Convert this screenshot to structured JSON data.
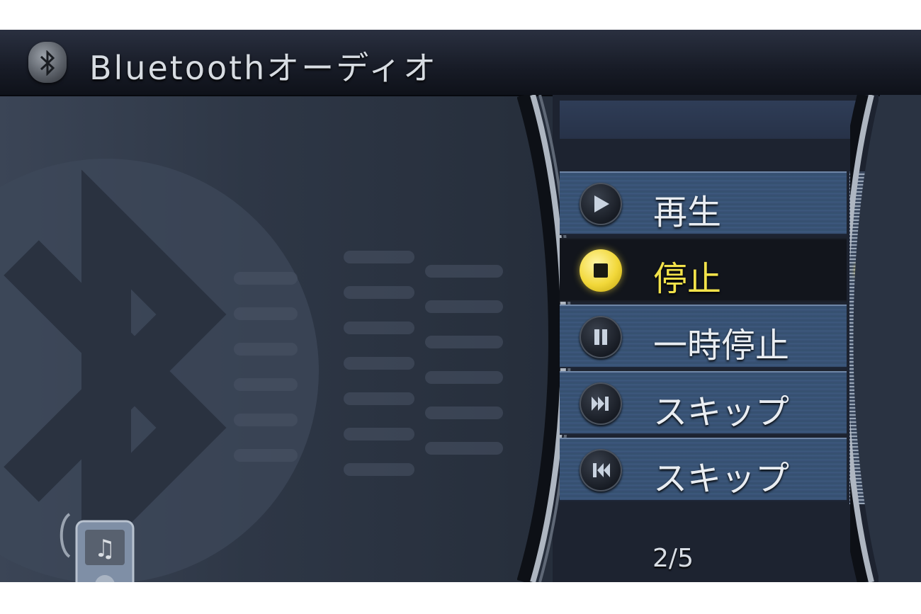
{
  "header": {
    "title": "Bluetoothオーディオ",
    "icon": "bluetooth-icon"
  },
  "menu": {
    "items": [
      {
        "label": "再生",
        "icon": "play-icon",
        "selected": false
      },
      {
        "label": "停止",
        "icon": "stop-icon",
        "selected": true
      },
      {
        "label": "一時停止",
        "icon": "pause-icon",
        "selected": false
      },
      {
        "label": "スキップ",
        "icon": "skip-forward-icon",
        "selected": false
      },
      {
        "label": "スキップ",
        "icon": "skip-back-icon",
        "selected": false
      }
    ]
  },
  "pagination": {
    "text": "2/5"
  },
  "colors": {
    "accent": "#f2e24a",
    "menu_bg": "#3a5377",
    "header_bg": "#171b26"
  }
}
